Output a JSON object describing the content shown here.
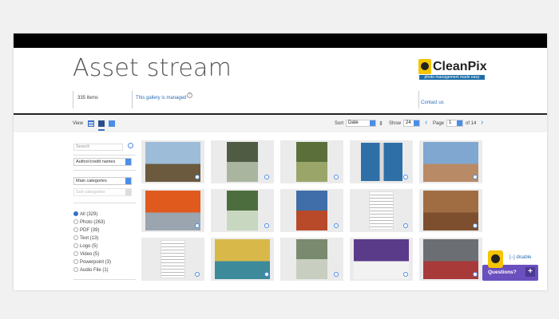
{
  "header": {
    "title": "Asset stream",
    "logo_text": "CleanPix",
    "logo_tagline": "photo management made easy",
    "items_count": "335 items",
    "managed_text": "This gallery is managed",
    "contact_text": "Contact us"
  },
  "toolbar": {
    "view_label": "View",
    "sort_label": "Sort",
    "sort_value": "Date",
    "show_label": "Show",
    "show_value": "24",
    "page_label": "Page",
    "page_value": "1",
    "page_total": "of 14"
  },
  "sidebar": {
    "search_placeholder": "Search",
    "author_select": "Author/credit names",
    "main_categories": "Main categories",
    "sub_categories": "Sub categories",
    "filters": [
      {
        "label": "All (329)",
        "selected": true
      },
      {
        "label": "Photo (263)",
        "selected": false
      },
      {
        "label": "PDF (39)",
        "selected": false
      },
      {
        "label": "Text (13)",
        "selected": false
      },
      {
        "label": "Logo (5)",
        "selected": false
      },
      {
        "label": "Video (5)",
        "selected": false
      },
      {
        "label": "Powerpoint (3)",
        "selected": false
      },
      {
        "label": "Audio File (1)",
        "selected": false
      }
    ]
  },
  "gallery": {
    "thumbs": [
      {
        "name": "tree-sky-photo",
        "kind": "photo",
        "bg": "#9dbcd8",
        "fg": "#6b5a3e"
      },
      {
        "name": "walkway-photo",
        "kind": "portrait",
        "bg": "#4f5b42",
        "fg": "#aab5a0"
      },
      {
        "name": "path-trees-photo",
        "kind": "portrait",
        "bg": "#5b6f3b",
        "fg": "#9aa56a"
      },
      {
        "name": "palm-poster",
        "kind": "poster",
        "bg": "#d8d8d8",
        "fg": "#2f6fa7"
      },
      {
        "name": "building-photo",
        "kind": "photo",
        "bg": "#7fa7d0",
        "fg": "#b98a66"
      },
      {
        "name": "orange-tree-building",
        "kind": "photo",
        "bg": "#e05a1e",
        "fg": "#9aa5b0"
      },
      {
        "name": "palm-photo",
        "kind": "portrait",
        "bg": "#4c6d3d",
        "fg": "#c8d7c0"
      },
      {
        "name": "red-tree-photo",
        "kind": "portrait",
        "bg": "#3f6ea8",
        "fg": "#b84a2a"
      },
      {
        "name": "text-document",
        "kind": "doc",
        "bg": "#f6f6f6",
        "fg": "#bbbbbb"
      },
      {
        "name": "leaves-photo",
        "kind": "photo",
        "bg": "#a06d43",
        "fg": "#7d4f2e"
      },
      {
        "name": "form-document",
        "kind": "doc",
        "bg": "#f2f2f2",
        "fg": "#bbbbbb"
      },
      {
        "name": "kids-wall-photo",
        "kind": "photo",
        "bg": "#d9b84a",
        "fg": "#3d8a9a"
      },
      {
        "name": "sculpture-photo",
        "kind": "portrait",
        "bg": "#7a8a6e",
        "fg": "#c9cfc0"
      },
      {
        "name": "purple-floor-photo",
        "kind": "photo",
        "bg": "#5a3b8a",
        "fg": "#f2f2f2"
      },
      {
        "name": "group-people-photo",
        "kind": "photo",
        "bg": "#6b6f73",
        "fg": "#a83a3a"
      }
    ]
  },
  "widget": {
    "questions_label": "Questions?",
    "plus_label": "+",
    "disable_label": "[–] disable"
  },
  "colors": {
    "accent": "#4a8ee8",
    "link": "#2a6ebb",
    "widget_purple": "#6a4fbf",
    "brand_yellow": "#f5c400"
  }
}
